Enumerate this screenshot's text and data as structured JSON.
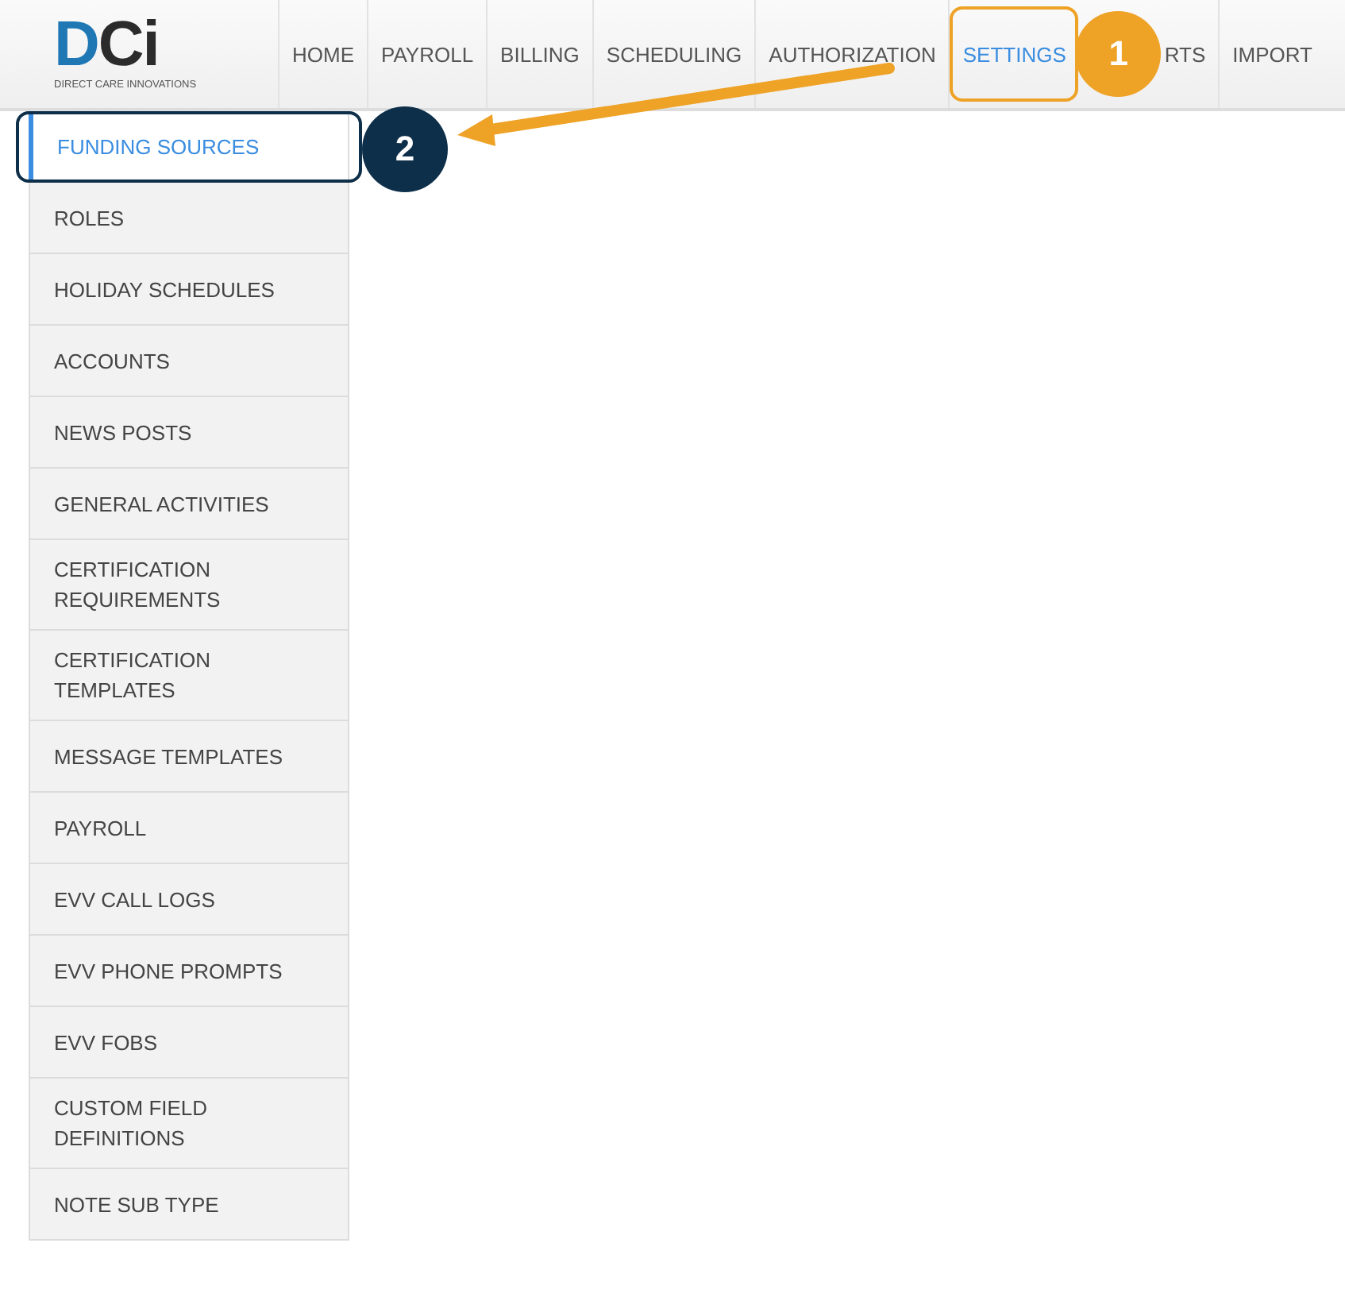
{
  "logo": {
    "letters": [
      "D",
      "C",
      "i"
    ],
    "tagline": "DIRECT CARE INNOVATIONS"
  },
  "nav": [
    {
      "label": "HOME",
      "selected": false
    },
    {
      "label": "PAYROLL",
      "selected": false
    },
    {
      "label": "BILLING",
      "selected": false
    },
    {
      "label": "SCHEDULING",
      "selected": false
    },
    {
      "label": "AUTHORIZATION",
      "selected": false
    },
    {
      "label": "SETTINGS",
      "selected": true
    },
    {
      "label": "RTS",
      "selected": false
    },
    {
      "label": "IMPORT",
      "selected": false
    }
  ],
  "sidebar": {
    "items": [
      {
        "label": "FUNDING SOURCES",
        "selected": true
      },
      {
        "label": "ROLES",
        "selected": false
      },
      {
        "label": "HOLIDAY SCHEDULES",
        "selected": false
      },
      {
        "label": "ACCOUNTS",
        "selected": false
      },
      {
        "label": "NEWS POSTS",
        "selected": false
      },
      {
        "label": "GENERAL ACTIVITIES",
        "selected": false
      },
      {
        "label": "CERTIFICATION REQUIREMENTS",
        "selected": false
      },
      {
        "label": "CERTIFICATION TEMPLATES",
        "selected": false
      },
      {
        "label": "MESSAGE TEMPLATES",
        "selected": false
      },
      {
        "label": "PAYROLL",
        "selected": false
      },
      {
        "label": "EVV CALL LOGS",
        "selected": false
      },
      {
        "label": "EVV PHONE PROMPTS",
        "selected": false
      },
      {
        "label": "EVV FOBS",
        "selected": false
      },
      {
        "label": "CUSTOM FIELD DEFINITIONS",
        "selected": false
      },
      {
        "label": "NOTE SUB TYPE",
        "selected": false
      }
    ]
  },
  "callouts": [
    {
      "label": "1",
      "color": "#eea226"
    },
    {
      "label": "2",
      "color": "#0e2f4a"
    }
  ]
}
